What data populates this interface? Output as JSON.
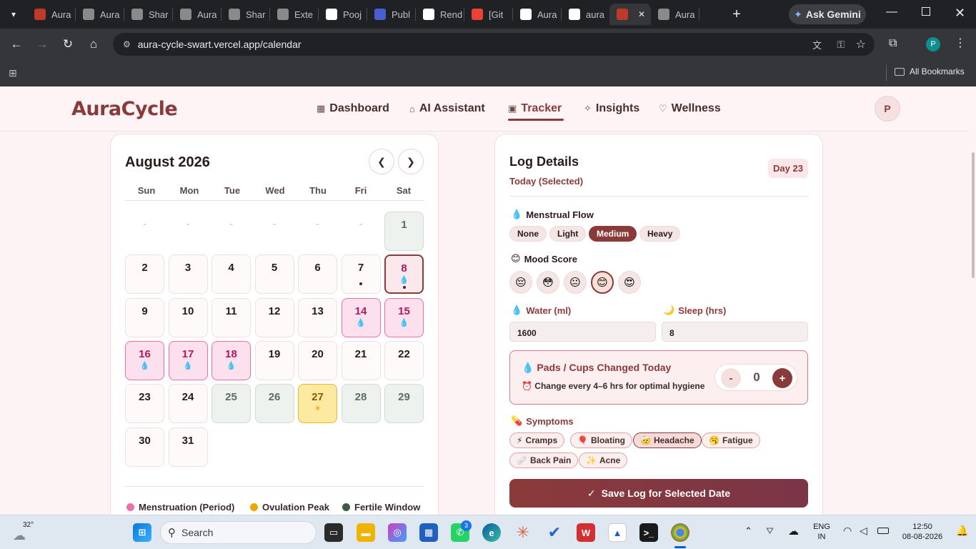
{
  "browser": {
    "tabs": [
      {
        "label": "Aura",
        "color": "#c0392b"
      },
      {
        "label": "Aura",
        "color": "#8a8a8a"
      },
      {
        "label": "Shar",
        "color": "#8a8a8a"
      },
      {
        "label": "Aura",
        "color": "#8a8a8a"
      },
      {
        "label": "Shar",
        "color": "#8a8a8a"
      },
      {
        "label": "Exte",
        "color": "#8a8a8a"
      },
      {
        "label": "Pooj",
        "color": "#ffffff"
      },
      {
        "label": "Publ",
        "color": "#4a5fd0"
      },
      {
        "label": "Rend",
        "color": "#ffffff"
      },
      {
        "label": "[Git",
        "color": "#ea4335"
      },
      {
        "label": "Aura",
        "color": "#ffffff"
      },
      {
        "label": "aura",
        "color": "#ffffff"
      },
      {
        "label": "",
        "color": "#c0392b"
      },
      {
        "label": "Aura",
        "color": "#8a8a8a"
      }
    ],
    "url": "aura-cycle-swart.vercel.app/calendar",
    "ask_gemini": "Ask Gemini",
    "profile_initial": "P",
    "all_bookmarks": "All Bookmarks"
  },
  "app": {
    "logo": "AuraCycle",
    "nav": [
      {
        "label": "Dashboard",
        "icon": "▦"
      },
      {
        "label": "AI Assistant",
        "icon": "⌂"
      },
      {
        "label": "Tracker",
        "icon": "▣"
      },
      {
        "label": "Insights",
        "icon": "✧"
      },
      {
        "label": "Wellness",
        "icon": "♡"
      }
    ],
    "avatar": "P"
  },
  "calendar": {
    "title": "August 2026",
    "weekdays": [
      "Sun",
      "Mon",
      "Tue",
      "Wed",
      "Thu",
      "Fri",
      "Sat"
    ],
    "empty_marker": "-",
    "days": [
      {
        "n": "1",
        "type": "fertile"
      },
      {
        "n": "2",
        "type": "normal"
      },
      {
        "n": "3",
        "type": "normal"
      },
      {
        "n": "4",
        "type": "normal"
      },
      {
        "n": "5",
        "type": "normal"
      },
      {
        "n": "6",
        "type": "normal"
      },
      {
        "n": "7",
        "type": "normal",
        "dot": true
      },
      {
        "n": "8",
        "type": "today",
        "drop": true,
        "dot": true
      },
      {
        "n": "9",
        "type": "normal"
      },
      {
        "n": "10",
        "type": "normal"
      },
      {
        "n": "11",
        "type": "normal"
      },
      {
        "n": "12",
        "type": "normal"
      },
      {
        "n": "13",
        "type": "normal"
      },
      {
        "n": "14",
        "type": "period",
        "drop": true
      },
      {
        "n": "15",
        "type": "period",
        "drop": true
      },
      {
        "n": "16",
        "type": "period",
        "drop": true
      },
      {
        "n": "17",
        "type": "period",
        "drop": true
      },
      {
        "n": "18",
        "type": "period",
        "drop": true
      },
      {
        "n": "19",
        "type": "normal"
      },
      {
        "n": "20",
        "type": "normal"
      },
      {
        "n": "21",
        "type": "normal"
      },
      {
        "n": "22",
        "type": "normal"
      },
      {
        "n": "23",
        "type": "normal"
      },
      {
        "n": "24",
        "type": "normal"
      },
      {
        "n": "25",
        "type": "fertile"
      },
      {
        "n": "26",
        "type": "fertile"
      },
      {
        "n": "27",
        "type": "ovul",
        "sun": true
      },
      {
        "n": "28",
        "type": "fertile"
      },
      {
        "n": "29",
        "type": "fertile"
      },
      {
        "n": "30",
        "type": "normal"
      },
      {
        "n": "31",
        "type": "normal"
      }
    ],
    "legend": [
      {
        "label": "Menstruation (Period)",
        "color": "#ec6fa8"
      },
      {
        "label": "Ovulation Peak",
        "color": "#f0a500"
      },
      {
        "label": "Fertile Window",
        "color": "#3d5a45"
      }
    ]
  },
  "log": {
    "title": "Log Details",
    "subtitle": "Today (Selected)",
    "day_badge": "Day 23",
    "flow_label": "Menstrual Flow",
    "flow_options": [
      "None",
      "Light",
      "Medium",
      "Heavy"
    ],
    "flow_selected": "Medium",
    "mood_label": "Mood Score",
    "moods": [
      "😔",
      "😳",
      "😐",
      "😊",
      "😍"
    ],
    "water_label": "Water (ml)",
    "water_value": "1600",
    "sleep_label": "Sleep (hrs)",
    "sleep_value": "8",
    "pads_title": "Pads / Cups Changed Today",
    "pads_sub": "Change every 4–6 hrs for optimal hygiene",
    "pads_minus": "-",
    "pads_count": "0",
    "pads_plus": "+",
    "symptoms_label": "Symptoms",
    "symptoms": [
      "Cramps",
      "Bloating",
      "Headache",
      "Fatigue",
      "Back Pain",
      "Acne"
    ],
    "symptom_icons": [
      "⚡",
      "🎈",
      "🤕",
      "🥱",
      "🩹",
      "✨"
    ],
    "save_label": "Save Log for Selected Date"
  },
  "taskbar": {
    "weather": "32°",
    "search": "Search",
    "whatsapp_badge": "3",
    "lang_top": "ENG",
    "lang_bottom": "IN",
    "time": "12:50",
    "date": "08-08-2026"
  }
}
